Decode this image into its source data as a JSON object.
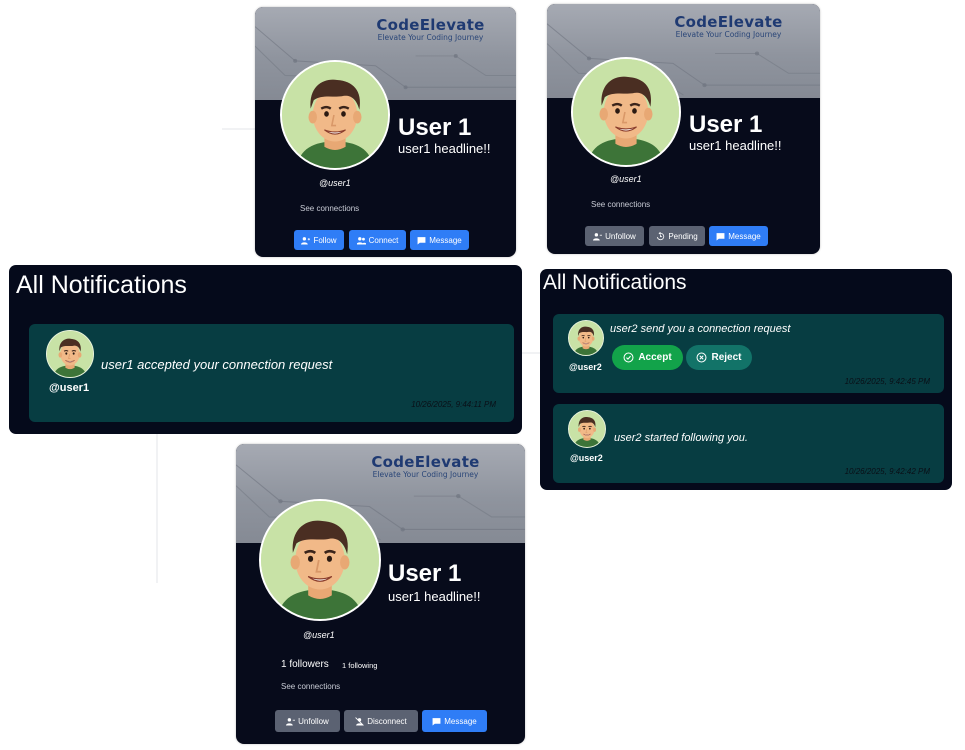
{
  "brand": {
    "name": "CodeElevate",
    "tagline": "Elevate Your Coding Journey"
  },
  "profile_cards": [
    {
      "state": "not-connected",
      "name": "User 1",
      "headline": "user1 headline!!",
      "handle": "@user1",
      "see_connections": "See connections",
      "buttons": [
        "Follow",
        "Connect",
        "Message"
      ]
    },
    {
      "state": "pending",
      "name": "User 1",
      "headline": "user1 headline!!",
      "handle": "@user1",
      "see_connections": "See connections",
      "buttons": [
        "Unfollow",
        "Pending",
        "Message"
      ]
    },
    {
      "state": "connected",
      "name": "User 1",
      "headline": "user1 headline!!",
      "handle": "@user1",
      "followers": "1 followers",
      "following": "1 following",
      "see_connections": "See connections",
      "buttons": [
        "Unfollow",
        "Disconnect",
        "Message"
      ]
    }
  ],
  "notifications_left": {
    "title": "All Notifications",
    "items": [
      {
        "user": "@user1",
        "message": "user1 accepted your connection request",
        "time": "10/26/2025, 9:44:11 PM"
      }
    ]
  },
  "notifications_right": {
    "title": "All Notifications",
    "items": [
      {
        "user": "@user2",
        "message": "user2 send you a connection request",
        "accept_label": "Accept",
        "reject_label": "Reject",
        "time": "10/26/2025, 9:42:45 PM"
      },
      {
        "user": "@user2",
        "message": "user2 started following you.",
        "time": "10/26/2025, 9:42:42 PM"
      }
    ]
  },
  "colors": {
    "card_bg": "#070b1b",
    "banner": "#8f949e",
    "brand_text": "#1f3a72",
    "button_blue": "#2f7df6",
    "button_gray": "#5b6272",
    "notification_item_bg": "#073d42",
    "accept_green": "#12a34a",
    "reject_teal": "#127368"
  },
  "icons": {
    "follow": "user-plus-icon",
    "connect": "users-icon",
    "message": "chat-icon",
    "unfollow": "user-minus-icon",
    "pending": "history-icon",
    "disconnect": "user-slash-icon",
    "accept": "check-circle-icon",
    "reject": "x-circle-icon",
    "avatar": "cartoon-avatar"
  }
}
